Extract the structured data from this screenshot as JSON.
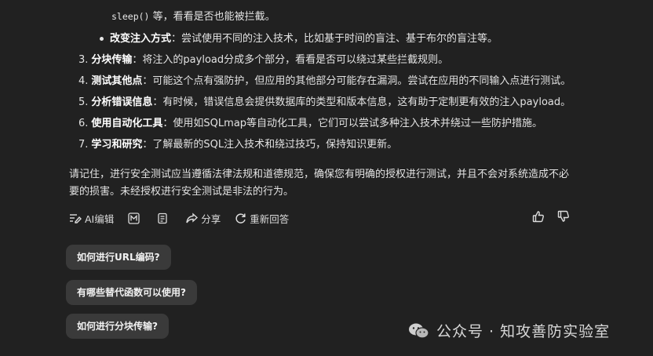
{
  "nested_bullet_cont": {
    "code": "sleep()",
    "rest": " 等，看看是否也能被拦截。"
  },
  "nested_bullet": {
    "bold": "改变注入方式",
    "text": "：尝试使用不同的注入技术，比如基于时间的盲注、基于布尔的盲注等。"
  },
  "list": [
    {
      "num": "3.",
      "bold": "分块传输",
      "text": "：将注入的payload分成多个部分，看看是否可以绕过某些拦截规则。"
    },
    {
      "num": "4.",
      "bold": "测试其他点",
      "text": "：可能这个点有强防护，但应用的其他部分可能存在漏洞。尝试在应用的不同输入点进行测试。"
    },
    {
      "num": "5.",
      "bold": "分析错误信息",
      "text": "：有时候，错误信息会提供数据库的类型和版本信息，这有助于定制更有效的注入payload。"
    },
    {
      "num": "6.",
      "bold": "使用自动化工具",
      "text": "：使用如SQLmap等自动化工具，它们可以尝试多种注入技术并绕过一些防护措施。"
    },
    {
      "num": "7.",
      "bold": "学习和研究",
      "text": "：了解最新的SQL注入技术和绕过技巧，保持知识更新。"
    }
  ],
  "paragraph": "请记住，进行安全测试应当遵循法律法规和道德规范，确保您有明确的授权进行测试，并且不会对系统造成不必要的损害。未经授权进行安全测试是非法的行为。",
  "toolbar": {
    "ai_edit": "AI编辑",
    "share": "分享",
    "regenerate": "重新回答"
  },
  "suggestions": [
    "如何进行URL编码?",
    "有哪些替代函数可以使用?",
    "如何进行分块传输?"
  ],
  "watermark": "公众号 · 知攻善防实验室"
}
